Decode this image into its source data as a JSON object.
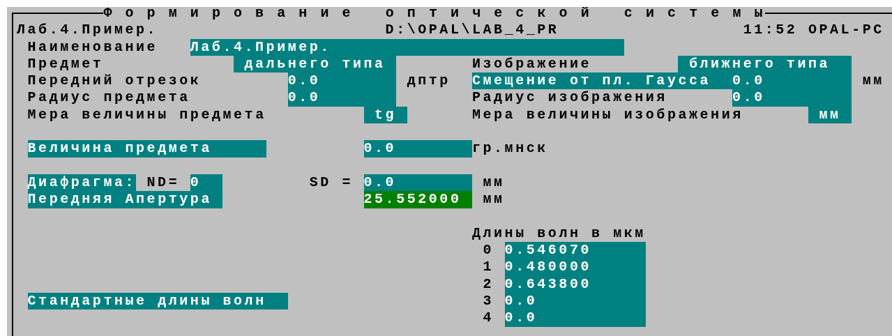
{
  "window": {
    "title": "Ф о р м и р о в а н и е   о п т и ч е с к о й   с и с т е м ы",
    "document": "Лаб.4.Пример.",
    "path": "D:\\OPAL\\LAB_4_PR",
    "status": "11:52 OPAL-PC"
  },
  "fields": [
    {
      "label": "Наименование",
      "highlighted": false,
      "value": "Лаб.4.Пример.",
      "selected": false
    },
    {
      "label": "Предмет",
      "highlighted": false,
      "value": "дальнего типа",
      "selected": false
    },
    {
      "label": "Изображение",
      "highlighted": false,
      "value": "ближнего типа",
      "selected": false
    },
    {
      "label": "Передний отрезок",
      "highlighted": false,
      "value": "0.0",
      "selected": false,
      "unit": "дптр"
    },
    {
      "label": "Смещение от пл. Гаусса",
      "highlighted": true,
      "value": "0.0",
      "selected": false,
      "unit": "мм"
    },
    {
      "label": "Радиус предмета",
      "highlighted": false,
      "value": "0.0",
      "selected": false
    },
    {
      "label": "Радиус изображения",
      "highlighted": false,
      "value": "0.0",
      "selected": false
    },
    {
      "label": "Мера величины предмета",
      "highlighted": false,
      "value": "tg",
      "selected": false
    },
    {
      "label": "Мера величины изображения",
      "highlighted": false,
      "value": "мм",
      "selected": false
    },
    {
      "label": "Величина предмета",
      "highlighted": true,
      "value": "0.0",
      "selected": false,
      "unit": "гр.мнск"
    },
    {
      "label": "Диафрагма:",
      "highlighted": true,
      "parameter": "ND=",
      "value": "0",
      "selected": false
    },
    {
      "label": "SD =",
      "highlighted": false,
      "value": "0.0",
      "selected": false,
      "unit": "мм"
    },
    {
      "label": "Передняя Апертура",
      "highlighted": true,
      "value": "25.552000",
      "selected": true,
      "unit": "мм"
    }
  ],
  "wavelengths": {
    "title": "Длины волн в мкм",
    "rows": [
      {
        "index": "0",
        "value": "0.546070"
      },
      {
        "index": "1",
        "value": "0.480000"
      },
      {
        "index": "2",
        "value": "0.643800"
      },
      {
        "index": "3",
        "value": "0.0"
      },
      {
        "index": "4",
        "value": "0.0"
      }
    ]
  },
  "standard_button": "Стандартные длины волн"
}
